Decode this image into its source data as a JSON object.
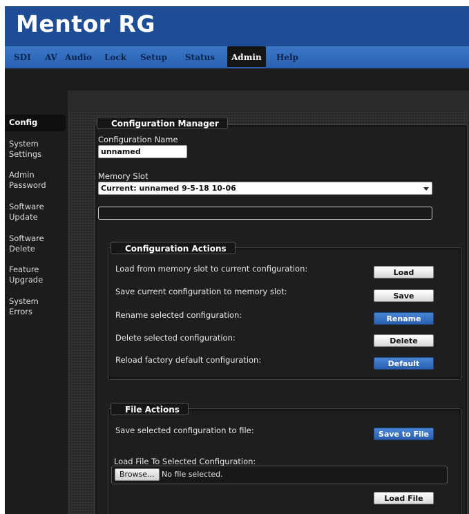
{
  "app": {
    "title": "Mentor RG"
  },
  "nav": {
    "tabs": [
      {
        "label": "SDI",
        "active": false
      },
      {
        "label": "AV",
        "active": false
      },
      {
        "label": "Audio",
        "active": false
      },
      {
        "label": "Lock",
        "active": false
      },
      {
        "label": "Setup",
        "active": false
      },
      {
        "label": "Status",
        "active": false
      },
      {
        "label": "Admin",
        "active": true
      },
      {
        "label": "Help",
        "active": false
      }
    ]
  },
  "sidebar": {
    "items": [
      {
        "label": "Config",
        "active": true
      },
      {
        "label": "System Settings",
        "active": false
      },
      {
        "label": "Admin Password",
        "active": false
      },
      {
        "label": "Software Update",
        "active": false
      },
      {
        "label": "Software Delete",
        "active": false
      },
      {
        "label": "Feature Upgrade",
        "active": false
      },
      {
        "label": "System Errors",
        "active": false
      }
    ]
  },
  "config_manager": {
    "legend": "Configuration Manager",
    "name_label": "Configuration Name",
    "name_value": "unnamed",
    "slot_label": "Memory Slot",
    "slot_value": "Current: unnamed 9-5-18 10-06"
  },
  "config_actions": {
    "legend": "Configuration Actions",
    "rows": [
      {
        "label": "Load from memory slot to current configuration:",
        "button": "Load"
      },
      {
        "label": "Save current configuration to memory slot:",
        "button": "Save"
      },
      {
        "label": "Rename selected configuration:",
        "button": "Rename"
      },
      {
        "label": "Delete selected configuration:",
        "button": "Delete"
      },
      {
        "label": "Reload factory default configuration:",
        "button": "Default"
      }
    ]
  },
  "file_actions": {
    "legend": "File Actions",
    "save_label": "Save selected configuration to file:",
    "save_button": "Save to File",
    "load_label": "Load File To Selected Configuration:",
    "browse_button": "Browse...",
    "browse_status": "No file selected.",
    "load_button": "Load File"
  },
  "colors": {
    "brand": "#1f4d95",
    "nav": "#3a78c9",
    "accent_button": "#2a5fae",
    "background": "#1c1c1c"
  }
}
